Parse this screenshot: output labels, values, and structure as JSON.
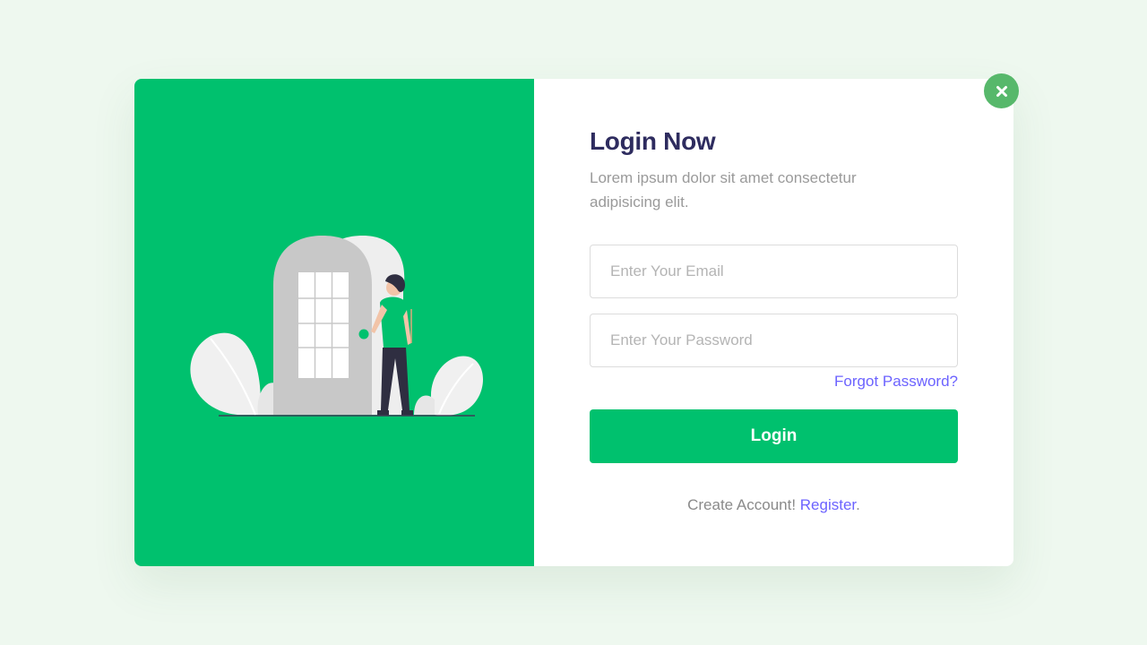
{
  "login": {
    "title": "Login Now",
    "subtitle": "Lorem ipsum dolor sit amet consectetur adipisicing elit.",
    "email_placeholder": "Enter Your Email",
    "password_placeholder": "Enter Your Password",
    "forgot_label": "Forgot Password?",
    "login_label": "Login",
    "register_prompt": "Create Account! ",
    "register_label": "Register",
    "register_suffix": "."
  },
  "icons": {
    "close": "close-icon",
    "illustration": "person-at-door-illustration"
  },
  "colors": {
    "page_background": "#eef8ef",
    "brand_green": "#00c16e",
    "close_button": "#57b86b",
    "title": "#2e2c5f",
    "link": "#6c63ff",
    "muted_text": "#9a9a9a"
  }
}
